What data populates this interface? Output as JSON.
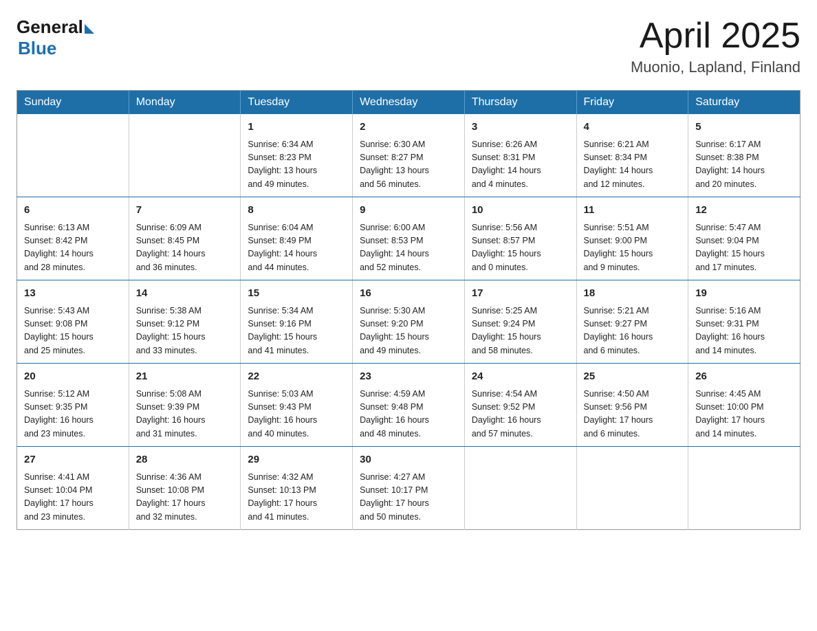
{
  "logo": {
    "general": "General",
    "blue": "Blue"
  },
  "title": "April 2025",
  "location": "Muonio, Lapland, Finland",
  "weekdays": [
    "Sunday",
    "Monday",
    "Tuesday",
    "Wednesday",
    "Thursday",
    "Friday",
    "Saturday"
  ],
  "weeks": [
    [
      {
        "day": "",
        "info": ""
      },
      {
        "day": "",
        "info": ""
      },
      {
        "day": "1",
        "info": "Sunrise: 6:34 AM\nSunset: 8:23 PM\nDaylight: 13 hours\nand 49 minutes."
      },
      {
        "day": "2",
        "info": "Sunrise: 6:30 AM\nSunset: 8:27 PM\nDaylight: 13 hours\nand 56 minutes."
      },
      {
        "day": "3",
        "info": "Sunrise: 6:26 AM\nSunset: 8:31 PM\nDaylight: 14 hours\nand 4 minutes."
      },
      {
        "day": "4",
        "info": "Sunrise: 6:21 AM\nSunset: 8:34 PM\nDaylight: 14 hours\nand 12 minutes."
      },
      {
        "day": "5",
        "info": "Sunrise: 6:17 AM\nSunset: 8:38 PM\nDaylight: 14 hours\nand 20 minutes."
      }
    ],
    [
      {
        "day": "6",
        "info": "Sunrise: 6:13 AM\nSunset: 8:42 PM\nDaylight: 14 hours\nand 28 minutes."
      },
      {
        "day": "7",
        "info": "Sunrise: 6:09 AM\nSunset: 8:45 PM\nDaylight: 14 hours\nand 36 minutes."
      },
      {
        "day": "8",
        "info": "Sunrise: 6:04 AM\nSunset: 8:49 PM\nDaylight: 14 hours\nand 44 minutes."
      },
      {
        "day": "9",
        "info": "Sunrise: 6:00 AM\nSunset: 8:53 PM\nDaylight: 14 hours\nand 52 minutes."
      },
      {
        "day": "10",
        "info": "Sunrise: 5:56 AM\nSunset: 8:57 PM\nDaylight: 15 hours\nand 0 minutes."
      },
      {
        "day": "11",
        "info": "Sunrise: 5:51 AM\nSunset: 9:00 PM\nDaylight: 15 hours\nand 9 minutes."
      },
      {
        "day": "12",
        "info": "Sunrise: 5:47 AM\nSunset: 9:04 PM\nDaylight: 15 hours\nand 17 minutes."
      }
    ],
    [
      {
        "day": "13",
        "info": "Sunrise: 5:43 AM\nSunset: 9:08 PM\nDaylight: 15 hours\nand 25 minutes."
      },
      {
        "day": "14",
        "info": "Sunrise: 5:38 AM\nSunset: 9:12 PM\nDaylight: 15 hours\nand 33 minutes."
      },
      {
        "day": "15",
        "info": "Sunrise: 5:34 AM\nSunset: 9:16 PM\nDaylight: 15 hours\nand 41 minutes."
      },
      {
        "day": "16",
        "info": "Sunrise: 5:30 AM\nSunset: 9:20 PM\nDaylight: 15 hours\nand 49 minutes."
      },
      {
        "day": "17",
        "info": "Sunrise: 5:25 AM\nSunset: 9:24 PM\nDaylight: 15 hours\nand 58 minutes."
      },
      {
        "day": "18",
        "info": "Sunrise: 5:21 AM\nSunset: 9:27 PM\nDaylight: 16 hours\nand 6 minutes."
      },
      {
        "day": "19",
        "info": "Sunrise: 5:16 AM\nSunset: 9:31 PM\nDaylight: 16 hours\nand 14 minutes."
      }
    ],
    [
      {
        "day": "20",
        "info": "Sunrise: 5:12 AM\nSunset: 9:35 PM\nDaylight: 16 hours\nand 23 minutes."
      },
      {
        "day": "21",
        "info": "Sunrise: 5:08 AM\nSunset: 9:39 PM\nDaylight: 16 hours\nand 31 minutes."
      },
      {
        "day": "22",
        "info": "Sunrise: 5:03 AM\nSunset: 9:43 PM\nDaylight: 16 hours\nand 40 minutes."
      },
      {
        "day": "23",
        "info": "Sunrise: 4:59 AM\nSunset: 9:48 PM\nDaylight: 16 hours\nand 48 minutes."
      },
      {
        "day": "24",
        "info": "Sunrise: 4:54 AM\nSunset: 9:52 PM\nDaylight: 16 hours\nand 57 minutes."
      },
      {
        "day": "25",
        "info": "Sunrise: 4:50 AM\nSunset: 9:56 PM\nDaylight: 17 hours\nand 6 minutes."
      },
      {
        "day": "26",
        "info": "Sunrise: 4:45 AM\nSunset: 10:00 PM\nDaylight: 17 hours\nand 14 minutes."
      }
    ],
    [
      {
        "day": "27",
        "info": "Sunrise: 4:41 AM\nSunset: 10:04 PM\nDaylight: 17 hours\nand 23 minutes."
      },
      {
        "day": "28",
        "info": "Sunrise: 4:36 AM\nSunset: 10:08 PM\nDaylight: 17 hours\nand 32 minutes."
      },
      {
        "day": "29",
        "info": "Sunrise: 4:32 AM\nSunset: 10:13 PM\nDaylight: 17 hours\nand 41 minutes."
      },
      {
        "day": "30",
        "info": "Sunrise: 4:27 AM\nSunset: 10:17 PM\nDaylight: 17 hours\nand 50 minutes."
      },
      {
        "day": "",
        "info": ""
      },
      {
        "day": "",
        "info": ""
      },
      {
        "day": "",
        "info": ""
      }
    ]
  ]
}
